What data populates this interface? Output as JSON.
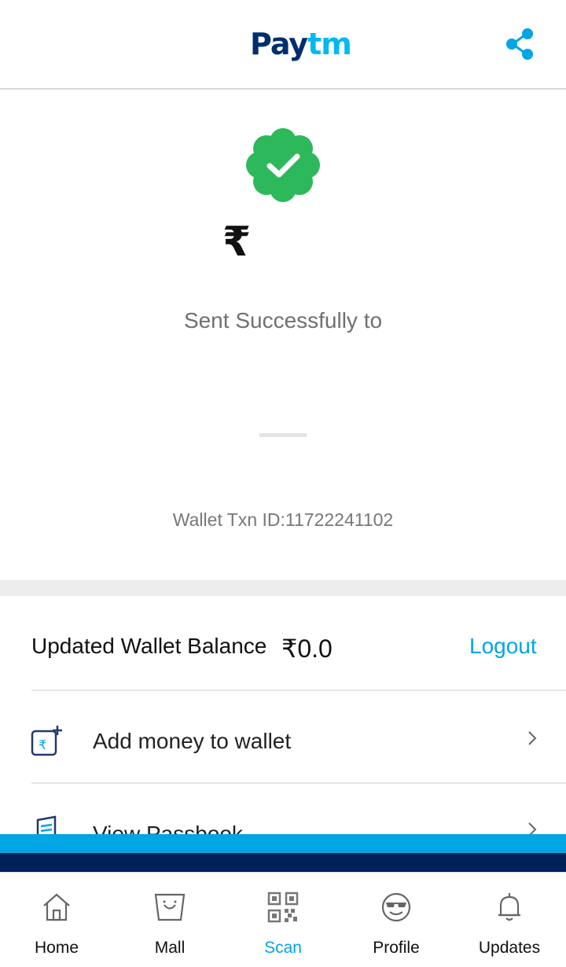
{
  "header": {
    "logo_part1": "Pay",
    "logo_part2": "tm",
    "share_icon": "share-icon"
  },
  "payment": {
    "status_icon": "success-check-badge-icon",
    "currency_symbol": "₹",
    "sent_text": "Sent Successfully to",
    "txn_id": "Wallet Txn ID:11722241102"
  },
  "wallet": {
    "balance_label": "Updated Wallet Balance",
    "balance_value": "₹0.0",
    "logout_label": "Logout"
  },
  "actions": [
    {
      "label": "Add money to wallet",
      "icon": "add-money-wallet-icon"
    },
    {
      "label": "View Passbook",
      "icon": "passbook-icon"
    }
  ],
  "tabs": [
    {
      "label": "Home",
      "icon": "home-icon",
      "active": false
    },
    {
      "label": "Mall",
      "icon": "mall-bag-icon",
      "active": false
    },
    {
      "label": "Scan",
      "icon": "qr-scan-icon",
      "active": true
    },
    {
      "label": "Profile",
      "icon": "profile-face-icon",
      "active": false
    },
    {
      "label": "Updates",
      "icon": "bell-icon",
      "active": false
    }
  ],
  "colors": {
    "brand_dark": "#002e6e",
    "brand_light": "#00b9f1",
    "accent": "#00a6e3",
    "success": "#2eb85c"
  }
}
